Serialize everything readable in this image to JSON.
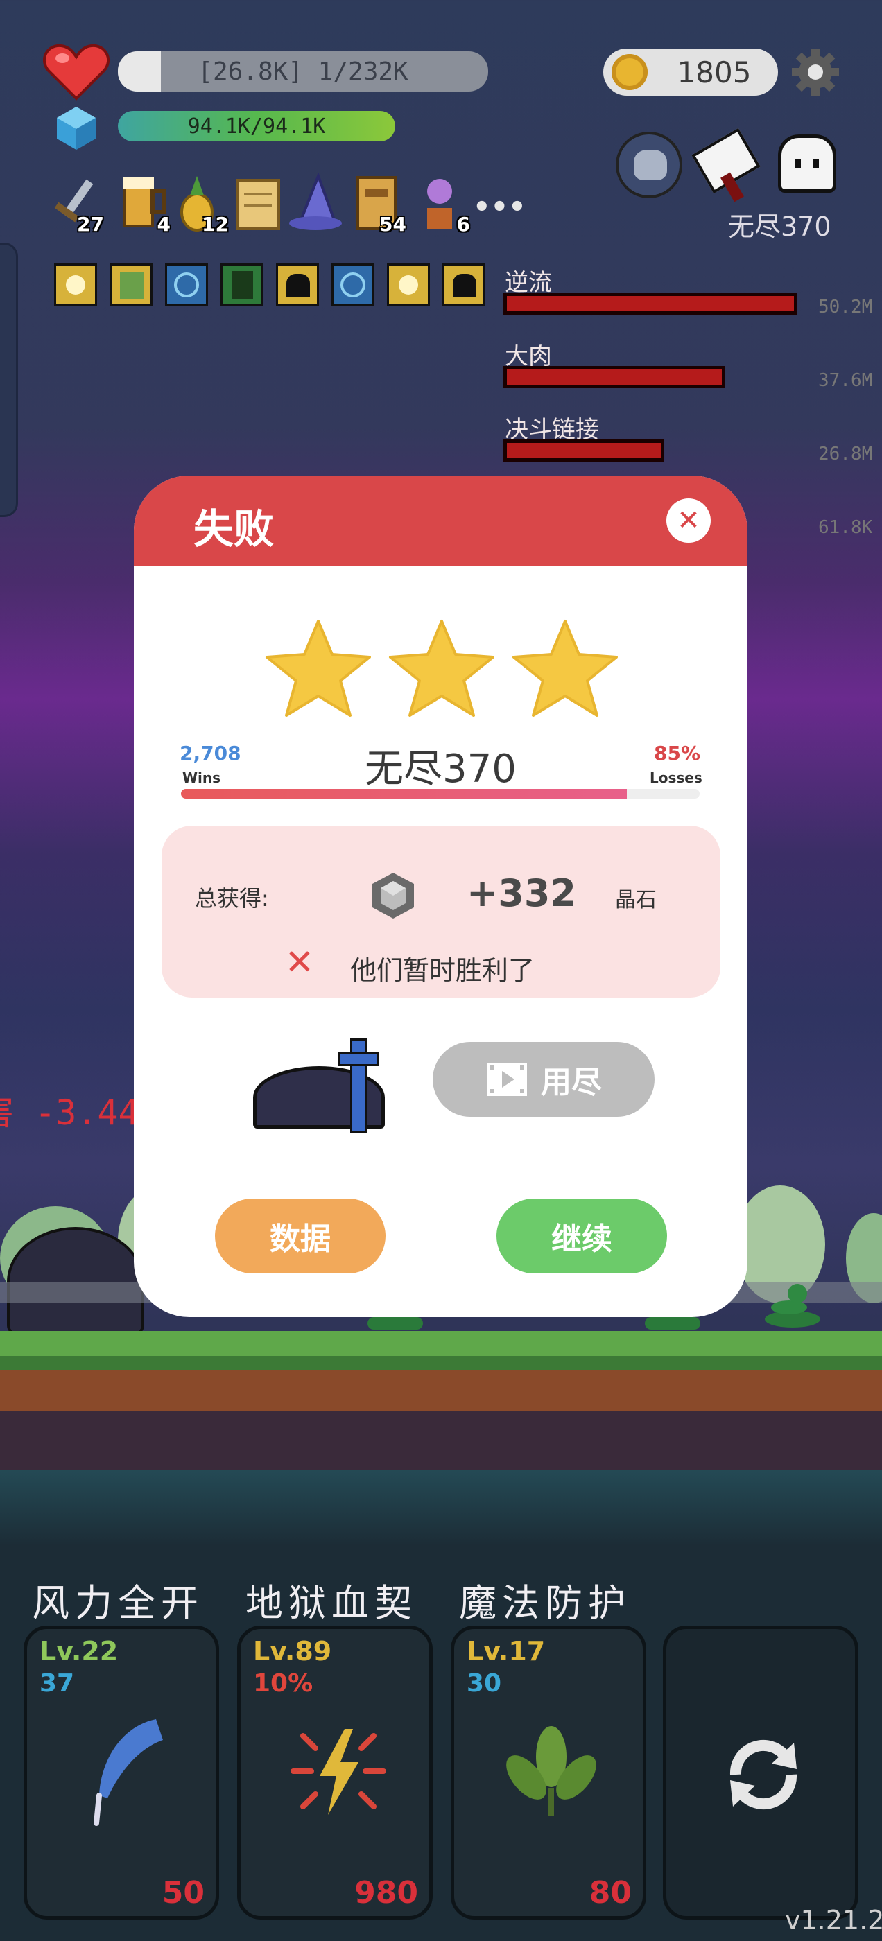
{
  "hud": {
    "hp_text": "[26.8K] 1/232K",
    "hp_fraction": 0.004,
    "shield_text": "94.1K/94.1K",
    "shield_fraction": 1.0,
    "coins": "1805",
    "stage_label": "无尽370"
  },
  "inventory": [
    {
      "icon": "sword-icon",
      "count": "27"
    },
    {
      "icon": "beer-mug-icon",
      "count": "4"
    },
    {
      "icon": "pineapple-icon",
      "count": "12"
    },
    {
      "icon": "scroll-icon",
      "count": ""
    },
    {
      "icon": "wizard-hat-icon",
      "count": ""
    },
    {
      "icon": "book-icon",
      "count": "54"
    },
    {
      "icon": "flower-pot-icon",
      "count": "6"
    }
  ],
  "damage": [
    {
      "label": "逆流",
      "value": "50.2M",
      "fraction": 1.0
    },
    {
      "label": "大肉",
      "value": "37.6M",
      "fraction": 0.75
    },
    {
      "label": "决斗链接",
      "value": "26.8M",
      "fraction": 0.54
    },
    {
      "label": "",
      "value": "61.8K",
      "fraction": 0.0
    }
  ],
  "floating_text": "害 -3.44",
  "modal": {
    "title": "失败",
    "stars": 3,
    "wins_value": "2,708",
    "wins_label": "Wins",
    "stage": "无尽370",
    "losses_value": "85%",
    "losses_label": "Losses",
    "progress_fraction": 0.86,
    "reward_label": "总获得:",
    "reward_amount": "+332",
    "reward_unit": "晶石",
    "result_text": "他们暂时胜利了",
    "video_button_label": "用尽",
    "stats_button_label": "数据",
    "continue_button_label": "继续"
  },
  "skills": [
    {
      "name": "风力全开",
      "level": "Lv.22",
      "sub": "37",
      "cost": "50",
      "icon": "feather-icon",
      "level_color": "#8fc85b",
      "sub_color": "#3aa7d6"
    },
    {
      "name": "地狱血契",
      "level": "Lv.89",
      "sub": "10%",
      "cost": "980",
      "icon": "lightning-burst-icon",
      "level_color": "#e0b83a",
      "sub_color": "#e0463c"
    },
    {
      "name": "魔法防护",
      "level": "Lv.17",
      "sub": "30",
      "cost": "80",
      "icon": "leaves-icon",
      "level_color": "#e0b83a",
      "sub_color": "#3aa7d6"
    }
  ],
  "version": "v1.21.2"
}
